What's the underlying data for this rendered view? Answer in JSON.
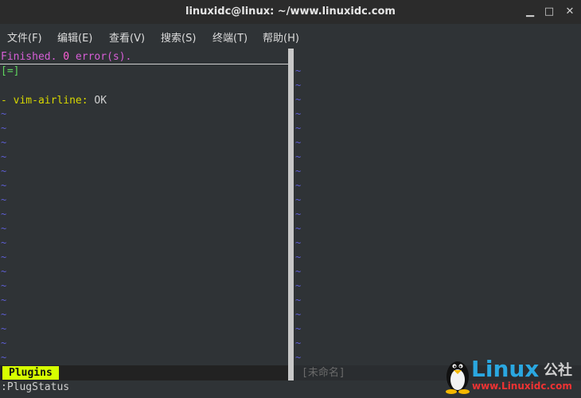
{
  "window": {
    "title": "linuxidc@linux: ~/www.linuxidc.com",
    "minimize_glyph": "▁",
    "maximize_glyph": "□",
    "close_glyph": "✕"
  },
  "menu": {
    "items": [
      "文件(F)",
      "编辑(E)",
      "查看(V)",
      "搜索(S)",
      "终端(T)",
      "帮助(H)"
    ]
  },
  "left_pane": {
    "finished_text_1": "Finished. ",
    "finished_errors": "0",
    "finished_text_2": " error(s).",
    "progress": "[=]",
    "plugin_prefix": "- ",
    "plugin_name": "vim-airline:",
    "plugin_status": " OK",
    "tilde": "~"
  },
  "right_pane": {
    "tilde": "~"
  },
  "statusline": {
    "left_tag": "Plugins",
    "right_name": "[未命名]"
  },
  "command_line": ":PlugStatus",
  "watermark": {
    "brand": "Linux",
    "suffix": "公社",
    "url": "www.Linuxidc.com"
  },
  "colors": {
    "accent_magenta": "#d75fd7",
    "plugin_yellow": "#d7d700",
    "tilde_blue": "#5f5fd7",
    "plugins_tag_bg": "#d7ff00",
    "progress_green": "#5fd75f"
  }
}
